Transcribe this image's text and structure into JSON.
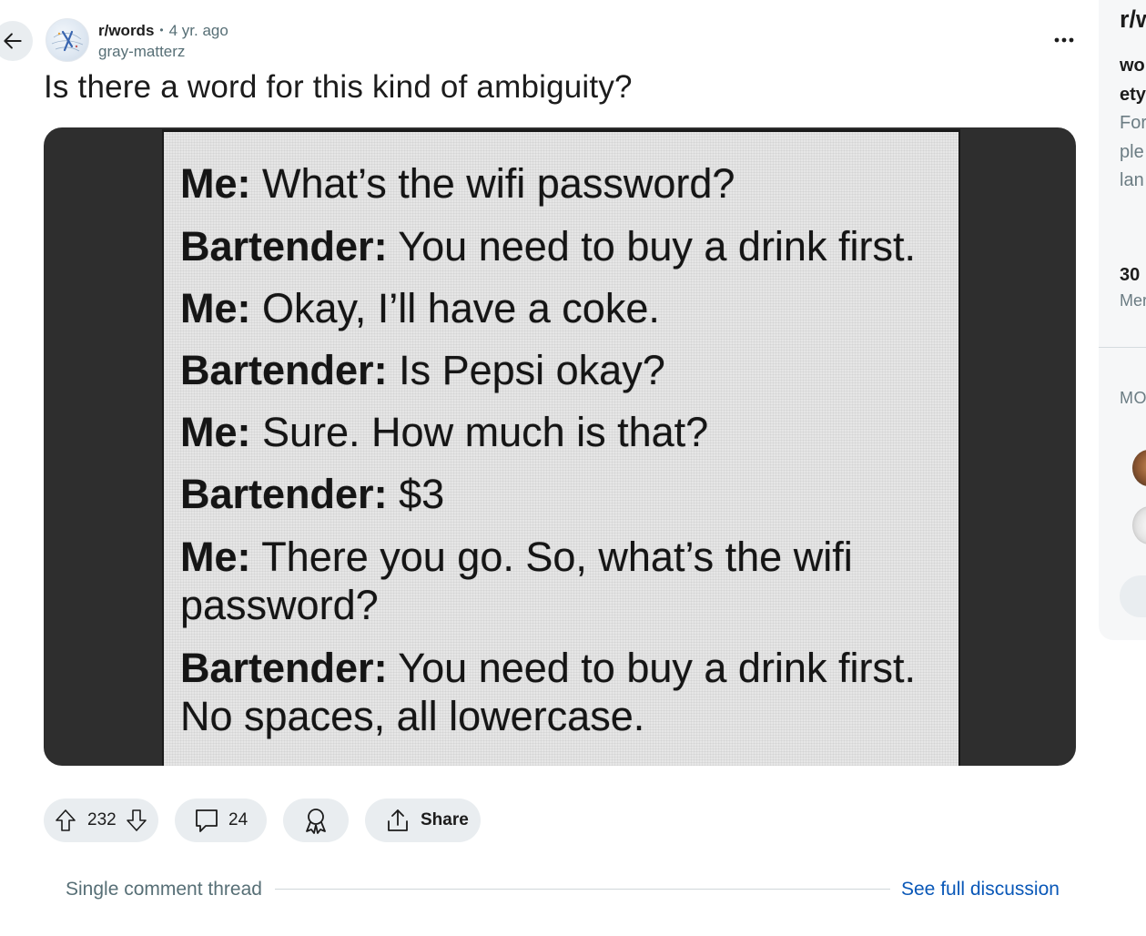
{
  "post": {
    "subreddit": "r/words",
    "separator": "•",
    "age": "4 yr. ago",
    "author": "gray-matterz",
    "title": "Is there a word for this kind of ambiguity?"
  },
  "image_text": {
    "lines": [
      {
        "speaker": "Me:",
        "text": " What’s the wifi password?"
      },
      {
        "speaker": "Bartender:",
        "text": " You need to buy a drink first."
      },
      {
        "speaker": "Me:",
        "text": " Okay, I’ll have a coke."
      },
      {
        "speaker": "Bartender:",
        "text": " Is Pepsi okay?"
      },
      {
        "speaker": "Me:",
        "text": " Sure. How much is that?"
      },
      {
        "speaker": "Bartender:",
        "text": " $3"
      },
      {
        "speaker": "Me:",
        "text": " There you go. So, what’s the wifi"
      },
      {
        "speaker": "",
        "text": "password?"
      },
      {
        "speaker": "Bartender:",
        "text": " You need to buy a drink first."
      },
      {
        "speaker": "",
        "text": "No spaces, all lowercase."
      }
    ]
  },
  "actions": {
    "votes": "232",
    "comments": "24",
    "share_label": "Share"
  },
  "thread": {
    "label": "Single comment thread",
    "link": "See full discussion"
  },
  "sidebar": {
    "title": "r/w",
    "desc_lines": [
      "wo",
      "ety",
      "For",
      "ple",
      "lan"
    ],
    "members_count": "30",
    "members_label": "Mer",
    "mods_heading": "MO"
  },
  "colors": {
    "pill_bg": "#e9edf0",
    "link": "#0a58b8",
    "muted": "#576f76",
    "media_bg": "#2e2e2e"
  },
  "icons": [
    "back-arrow-icon",
    "more-options-icon",
    "upvote-icon",
    "downvote-icon",
    "comment-icon",
    "award-icon",
    "share-icon"
  ]
}
